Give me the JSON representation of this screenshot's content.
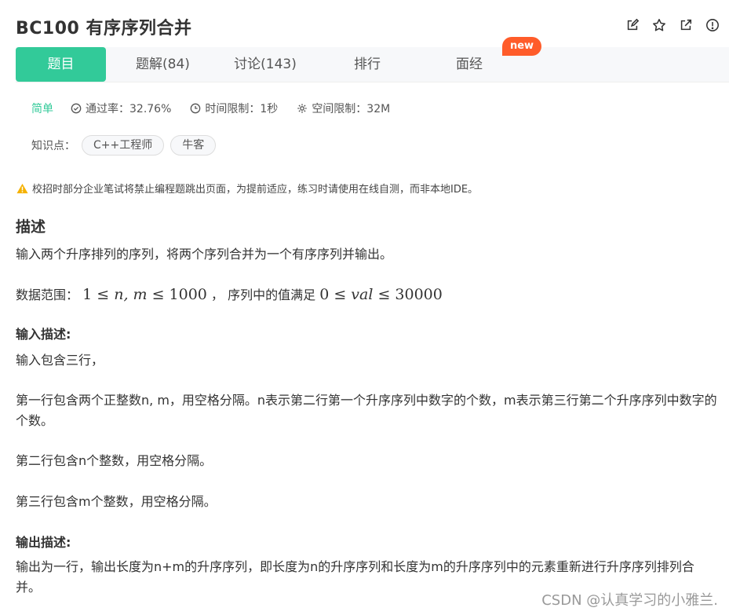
{
  "header": {
    "title": "BC100  有序序列合并",
    "icons": [
      "edit-icon",
      "star-icon",
      "external-link-icon",
      "info-icon"
    ]
  },
  "tabs": [
    {
      "label": "题目",
      "active": true
    },
    {
      "label": "题解(84)",
      "active": false
    },
    {
      "label": "讨论(143)",
      "active": false
    },
    {
      "label": "排行",
      "active": false
    },
    {
      "label": "面经",
      "active": false
    }
  ],
  "new_badge": "new",
  "meta": {
    "difficulty": "简单",
    "pass_rate": "通过率：32.76%",
    "time_limit": "时间限制：1秒",
    "space_limit": "空间限制：32M"
  },
  "knowledge": {
    "label": "知识点：",
    "tags": [
      "C++工程师",
      "牛客"
    ]
  },
  "warning": "校招时部分企业笔试将禁止编程题跳出页面，为提前适应，练习时请使用在线自测，而非本地IDE。",
  "description": {
    "heading": "描述",
    "line1": "输入两个升序排列的序列，将两个序列合并为一个有序序列并输出。",
    "range_prefix": "数据范围：",
    "range_math1_a": "1 ≤ ",
    "range_math1_var": "n, m",
    "range_math1_b": " ≤ 1000",
    "range_mid": "，  序列中的值满足",
    "range_math2_a": "0 ≤ ",
    "range_math2_var": "val",
    "range_math2_b": " ≤ 30000"
  },
  "input": {
    "heading": "输入描述:",
    "p1": "输入包含三行，",
    "p2": "第一行包含两个正整数n, m，用空格分隔。n表示第二行第一个升序序列中数字的个数，m表示第三行第二个升序序列中数字的个数。",
    "p3": "第二行包含n个整数，用空格分隔。",
    "p4": "第三行包含m个整数，用空格分隔。"
  },
  "output": {
    "heading": "输出描述:",
    "p1": "输出为一行，输出长度为n+m的升序序列，即长度为n的升序序列和长度为m的升序序列中的元素重新进行升序序列排列合并。"
  },
  "watermark": "CSDN @认真学习的小雅兰.",
  "colors": {
    "accent": "#32ca99",
    "badge": "#ff5c2a",
    "warning": "#f5b100"
  }
}
